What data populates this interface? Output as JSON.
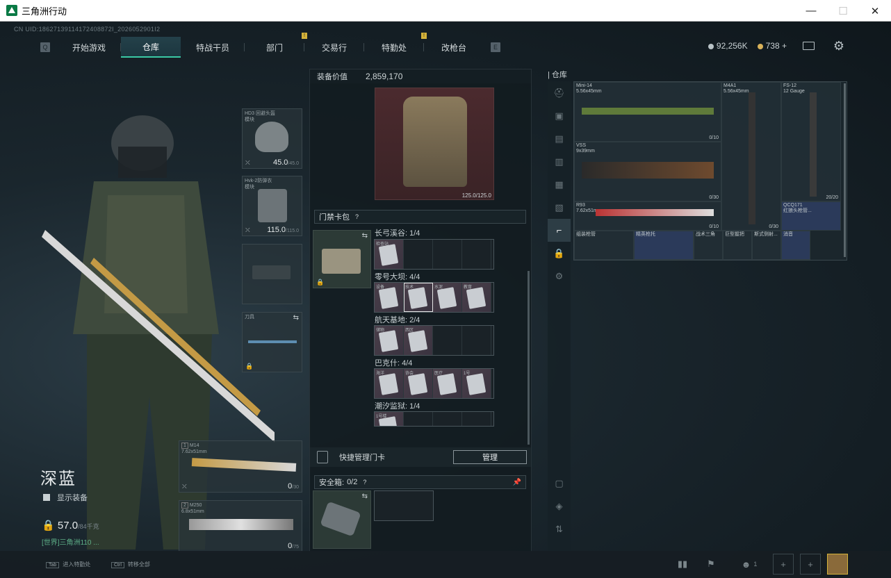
{
  "window": {
    "title": "三角洲行动"
  },
  "uid": "CN UID:18627139114172408872I_2026052901I2",
  "nav": {
    "tabs": [
      {
        "label": "开始游戏",
        "active": false,
        "notif": ""
      },
      {
        "label": "仓库",
        "active": true,
        "notif": ""
      },
      {
        "label": "特战干员",
        "active": false,
        "notif": ""
      },
      {
        "label": "部门",
        "active": false,
        "notif": "!"
      },
      {
        "label": "交易行",
        "active": false,
        "notif": ""
      },
      {
        "label": "特勤处",
        "active": false,
        "notif": "!"
      },
      {
        "label": "改枪台",
        "active": false,
        "notif": ""
      }
    ],
    "left_key": "Q",
    "right_key": "E"
  },
  "currency": {
    "coins": "92,256K",
    "tickets": "738 +",
    "coin_color": "#b9c3c7",
    "ticket_color": "#d9b25a"
  },
  "character": {
    "name": "深蓝",
    "show_equipment": "显示装备",
    "weight": "57.0",
    "weight_max": "/84千克",
    "level_text": "[世界]三角洲110 ..."
  },
  "gear": {
    "helmet": {
      "label": "HD3 回避头盔",
      "sub": "模块",
      "val": "45.0",
      "max": "/45.0"
    },
    "armor": {
      "label": "Hvk-2防弹衣",
      "sub": "模块",
      "val": "115.0",
      "max": "/115.0"
    },
    "pistol": {
      "label": ""
    },
    "melee": {
      "label": "刀具"
    },
    "primary": {
      "slot": "1",
      "name": "M14",
      "cal": "7.62x51mm",
      "ammo": "0",
      "ammo_max": "/30"
    },
    "secondary": {
      "slot": "2",
      "name": "M250",
      "cal": "6.8x51mm",
      "ammo": "0",
      "ammo_max": "/75"
    }
  },
  "center": {
    "value_label": "装备价值",
    "value": "2,859,170",
    "armor_val": "125.0/125.0",
    "cardpack_label": "门禁卡包",
    "maps": [
      {
        "name": "长弓溪谷: 1/4",
        "cards": [
          "检查站"
        ]
      },
      {
        "name": "零号大坝: 4/4",
        "cards": [
          "设备",
          "技术",
          "水泥",
          "教育"
        ]
      },
      {
        "name": "航天基地: 2/4",
        "cards": [
          "储物",
          "西区"
        ]
      },
      {
        "name": "巴克什: 4/4",
        "cards": [
          "海洋",
          "协会",
          "医疗",
          "1号"
        ]
      },
      {
        "name": "潮汐监狱: 1/4",
        "cards": [
          "1号楼"
        ]
      }
    ],
    "quick_label": "快捷管理门卡",
    "manage_btn": "管理",
    "safebox_label": "安全箱:",
    "safebox_count": "0/2"
  },
  "storage": {
    "title": "仓库",
    "weapons": [
      {
        "name": "Mini-14",
        "cal": "5.56x45mm",
        "ammo": "0/10"
      },
      {
        "name": "VSS",
        "cal": "9x39mm",
        "ammo": "0/30"
      },
      {
        "name": "R93",
        "cal": "7.62x51mm",
        "ammo": "0/10"
      },
      {
        "name": "M4A1",
        "cal": "5.56x45mm",
        "ammo": "0/30"
      },
      {
        "name": "FS-12",
        "cal": "12 Gauge",
        "ammo": "20/20"
      },
      {
        "name": "QCQ171",
        "cal": "红狼头枪管...",
        "ammo": ""
      }
    ],
    "attachments": [
      "组装枪管",
      "精英枪托",
      "战术三角",
      "巨型握把",
      "斯式侧射...",
      "消音"
    ]
  },
  "bottom": {
    "hint1_key": "Tab",
    "hint1": "进入特勤处",
    "hint2_key": "Ctrl",
    "hint2": "转移全部",
    "team_count": "1"
  }
}
